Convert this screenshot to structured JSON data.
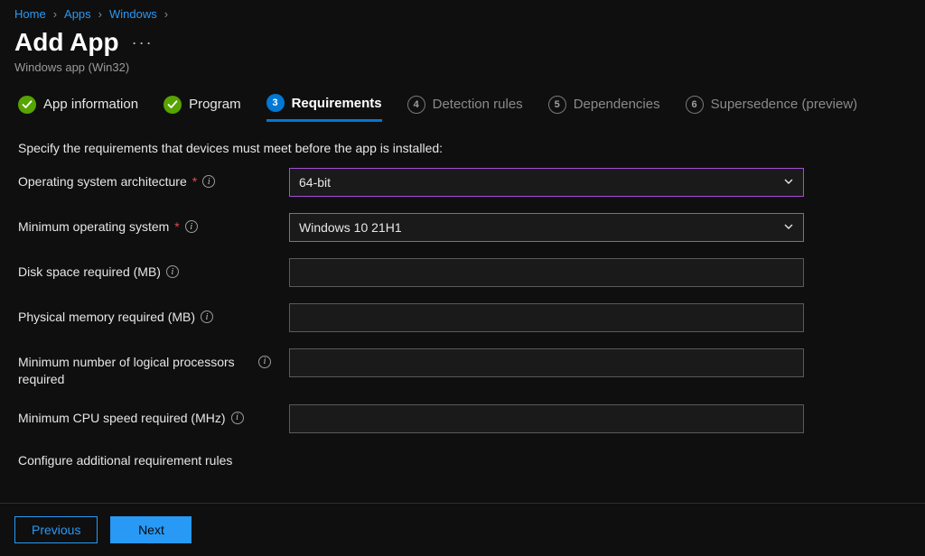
{
  "breadcrumb": {
    "home": "Home",
    "apps": "Apps",
    "windows": "Windows"
  },
  "header": {
    "title": "Add App",
    "subtitle": "Windows app (Win32)"
  },
  "tabs": {
    "app_info": "App information",
    "program": "Program",
    "requirements": "Requirements",
    "detection": "Detection rules",
    "dependencies": "Dependencies",
    "supersedence": "Supersedence (preview)",
    "n3": "3",
    "n4": "4",
    "n5": "5",
    "n6": "6"
  },
  "intro": "Specify the requirements that devices must meet before the app is installed:",
  "fields": {
    "arch_label": "Operating system architecture",
    "arch_value": "64-bit",
    "minos_label": "Minimum operating system",
    "minos_value": "Windows 10 21H1",
    "disk_label": "Disk space required (MB)",
    "disk_value": "",
    "mem_label": "Physical memory required (MB)",
    "mem_value": "",
    "cpu_count_label": "Minimum number of logical processors required",
    "cpu_count_value": "",
    "cpu_speed_label": "Minimum CPU speed required (MHz)",
    "cpu_speed_value": ""
  },
  "extra_rules_label": "Configure additional requirement rules",
  "buttons": {
    "previous": "Previous",
    "next": "Next"
  },
  "required_mark": "*"
}
